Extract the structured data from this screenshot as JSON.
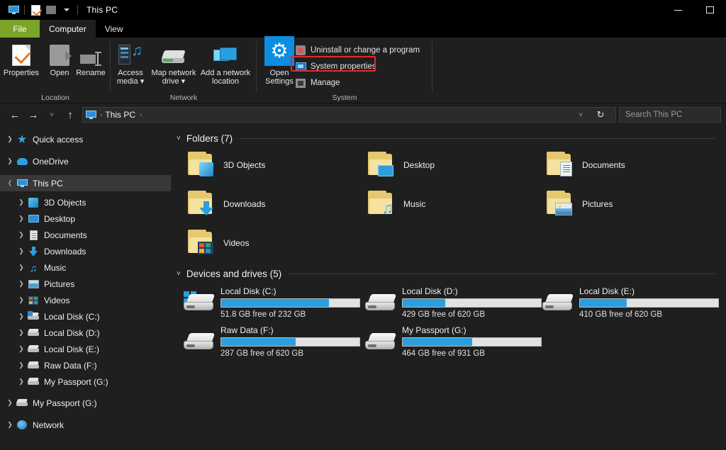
{
  "window": {
    "title": "This PC",
    "quick_access": [
      "monitor-icon",
      "properties-icon",
      "folder-icon",
      "dropdown-icon"
    ],
    "controls": {
      "minimize": "–",
      "maximize": "□"
    }
  },
  "ribbon": {
    "tabs": [
      {
        "label": "File",
        "state": "file"
      },
      {
        "label": "Computer",
        "state": "active"
      },
      {
        "label": "View",
        "state": "normal"
      }
    ],
    "groups": [
      {
        "label": "Location",
        "buttons": [
          {
            "label": "Properties",
            "icon": "properties-icon"
          },
          {
            "label": "Open",
            "icon": "open-icon"
          },
          {
            "label": "Rename",
            "icon": "rename-icon"
          }
        ]
      },
      {
        "label": "Network",
        "buttons": [
          {
            "label": "Access media ▾",
            "icon": "access-media-icon"
          },
          {
            "label": "Map network drive ▾",
            "icon": "map-network-drive-icon"
          },
          {
            "label": "Add a network location",
            "icon": "add-network-location-icon"
          }
        ]
      },
      {
        "label": "System",
        "buttons": [
          {
            "label": "Open Settings",
            "icon": "settings-gear-icon"
          }
        ],
        "small_items": [
          {
            "label": "Uninstall or change a program",
            "icon": "uninstall-icon",
            "highlighted": false
          },
          {
            "label": "System properties",
            "icon": "system-properties-icon",
            "highlighted": true
          },
          {
            "label": "Manage",
            "icon": "manage-icon",
            "highlighted": false
          }
        ]
      }
    ],
    "highlight_color": "#e52a28"
  },
  "addressbar": {
    "back": "←",
    "forward": "→",
    "recent": "˅",
    "up": "↑",
    "crumb_icon": "this-pc-icon",
    "crumb": "This PC",
    "crumb_sep": "›",
    "dropdown": "˅",
    "refresh": "↻",
    "search_placeholder": "Search This PC"
  },
  "sidebar": {
    "items": [
      {
        "label": "Quick access",
        "icon": "star-icon",
        "indent": 0,
        "expander": "collapsed",
        "selected": false
      },
      {
        "label": "OneDrive",
        "icon": "cloud-icon",
        "indent": 0,
        "expander": "collapsed",
        "selected": false
      },
      {
        "label": "This PC",
        "icon": "this-pc-icon",
        "indent": 0,
        "expander": "expanded",
        "selected": true
      },
      {
        "label": "3D Objects",
        "icon": "3d-objects-icon",
        "indent": 1,
        "expander": "collapsed",
        "selected": false
      },
      {
        "label": "Desktop",
        "icon": "desktop-icon",
        "indent": 1,
        "expander": "collapsed",
        "selected": false
      },
      {
        "label": "Documents",
        "icon": "documents-icon",
        "indent": 1,
        "expander": "collapsed",
        "selected": false
      },
      {
        "label": "Downloads",
        "icon": "downloads-icon",
        "indent": 1,
        "expander": "collapsed",
        "selected": false
      },
      {
        "label": "Music",
        "icon": "music-icon",
        "indent": 1,
        "expander": "collapsed",
        "selected": false
      },
      {
        "label": "Pictures",
        "icon": "pictures-icon",
        "indent": 1,
        "expander": "collapsed",
        "selected": false
      },
      {
        "label": "Videos",
        "icon": "videos-icon",
        "indent": 1,
        "expander": "collapsed",
        "selected": false
      },
      {
        "label": "Local Disk (C:)",
        "icon": "windows-drive-icon",
        "indent": 1,
        "expander": "collapsed",
        "selected": false
      },
      {
        "label": "Local Disk (D:)",
        "icon": "drive-icon",
        "indent": 1,
        "expander": "collapsed",
        "selected": false
      },
      {
        "label": "Local Disk (E:)",
        "icon": "drive-icon",
        "indent": 1,
        "expander": "collapsed",
        "selected": false
      },
      {
        "label": "Raw Data (F:)",
        "icon": "drive-icon",
        "indent": 1,
        "expander": "collapsed",
        "selected": false
      },
      {
        "label": "My Passport (G:)",
        "icon": "drive-icon",
        "indent": 1,
        "expander": "collapsed",
        "selected": false
      },
      {
        "label": "My Passport (G:)",
        "icon": "drive-icon",
        "indent": 0,
        "expander": "collapsed",
        "selected": false
      },
      {
        "label": "Network",
        "icon": "network-icon",
        "indent": 0,
        "expander": "collapsed",
        "selected": false
      }
    ]
  },
  "content": {
    "folders_section": {
      "chevron": "˅",
      "title": "Folders (7)",
      "items": [
        {
          "label": "3D Objects",
          "icon": "folder-3d-objects-icon"
        },
        {
          "label": "Desktop",
          "icon": "folder-desktop-icon"
        },
        {
          "label": "Documents",
          "icon": "folder-documents-icon"
        },
        {
          "label": "Downloads",
          "icon": "folder-downloads-icon"
        },
        {
          "label": "Music",
          "icon": "folder-music-icon"
        },
        {
          "label": "Pictures",
          "icon": "folder-pictures-icon"
        },
        {
          "label": "Videos",
          "icon": "folder-videos-icon"
        }
      ]
    },
    "drives_section": {
      "chevron": "˅",
      "title": "Devices and drives (5)",
      "items": [
        {
          "label": "Local Disk (C:)",
          "free": "51.8 GB free of 232 GB",
          "used_pct": 78,
          "icon": "windows-drive-icon"
        },
        {
          "label": "Local Disk (D:)",
          "free": "429 GB free of 620 GB",
          "used_pct": 31,
          "icon": "drive-icon"
        },
        {
          "label": "Local Disk (E:)",
          "free": "410 GB free of 620 GB",
          "used_pct": 34,
          "icon": "drive-icon"
        },
        {
          "label": "Raw Data (F:)",
          "free": "287 GB free of 620 GB",
          "used_pct": 54,
          "icon": "drive-icon"
        },
        {
          "label": "My Passport (G:)",
          "free": "464 GB free of 931 GB",
          "used_pct": 50,
          "icon": "drive-icon"
        }
      ],
      "bar_fill_color": "#2b9ede",
      "bar_track_color": "#e2e2e2"
    }
  }
}
